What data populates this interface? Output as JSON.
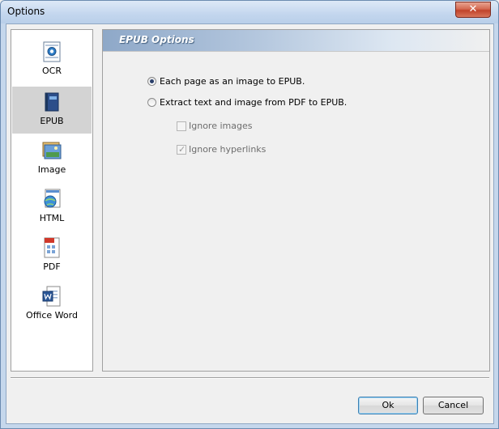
{
  "window": {
    "title": "Options",
    "close_label": "✕"
  },
  "sidebar": {
    "items": [
      {
        "label": "OCR",
        "icon": "ocr-icon",
        "selected": false
      },
      {
        "label": "EPUB",
        "icon": "epub-book-icon",
        "selected": true
      },
      {
        "label": "Image",
        "icon": "image-icon",
        "selected": false
      },
      {
        "label": "HTML",
        "icon": "html-globe-icon",
        "selected": false
      },
      {
        "label": "PDF",
        "icon": "pdf-icon",
        "selected": false
      },
      {
        "label": "Office Word",
        "icon": "word-icon",
        "selected": false
      }
    ]
  },
  "panel": {
    "title": "EPUB Options",
    "options": [
      {
        "label": "Each page as an image to EPUB.",
        "type": "radio",
        "checked": true,
        "enabled": true
      },
      {
        "label": "Extract text and image from PDF to EPUB.",
        "type": "radio",
        "checked": false,
        "enabled": true
      },
      {
        "label": "Ignore images",
        "type": "checkbox",
        "checked": false,
        "enabled": false
      },
      {
        "label": "Ignore hyperlinks",
        "type": "checkbox",
        "checked": true,
        "enabled": false
      }
    ]
  },
  "footer": {
    "ok_label": "Ok",
    "cancel_label": "Cancel"
  },
  "colors": {
    "accent": "#2a3f6a",
    "selection": "#d3d3d3",
    "close": "#c0432a"
  }
}
